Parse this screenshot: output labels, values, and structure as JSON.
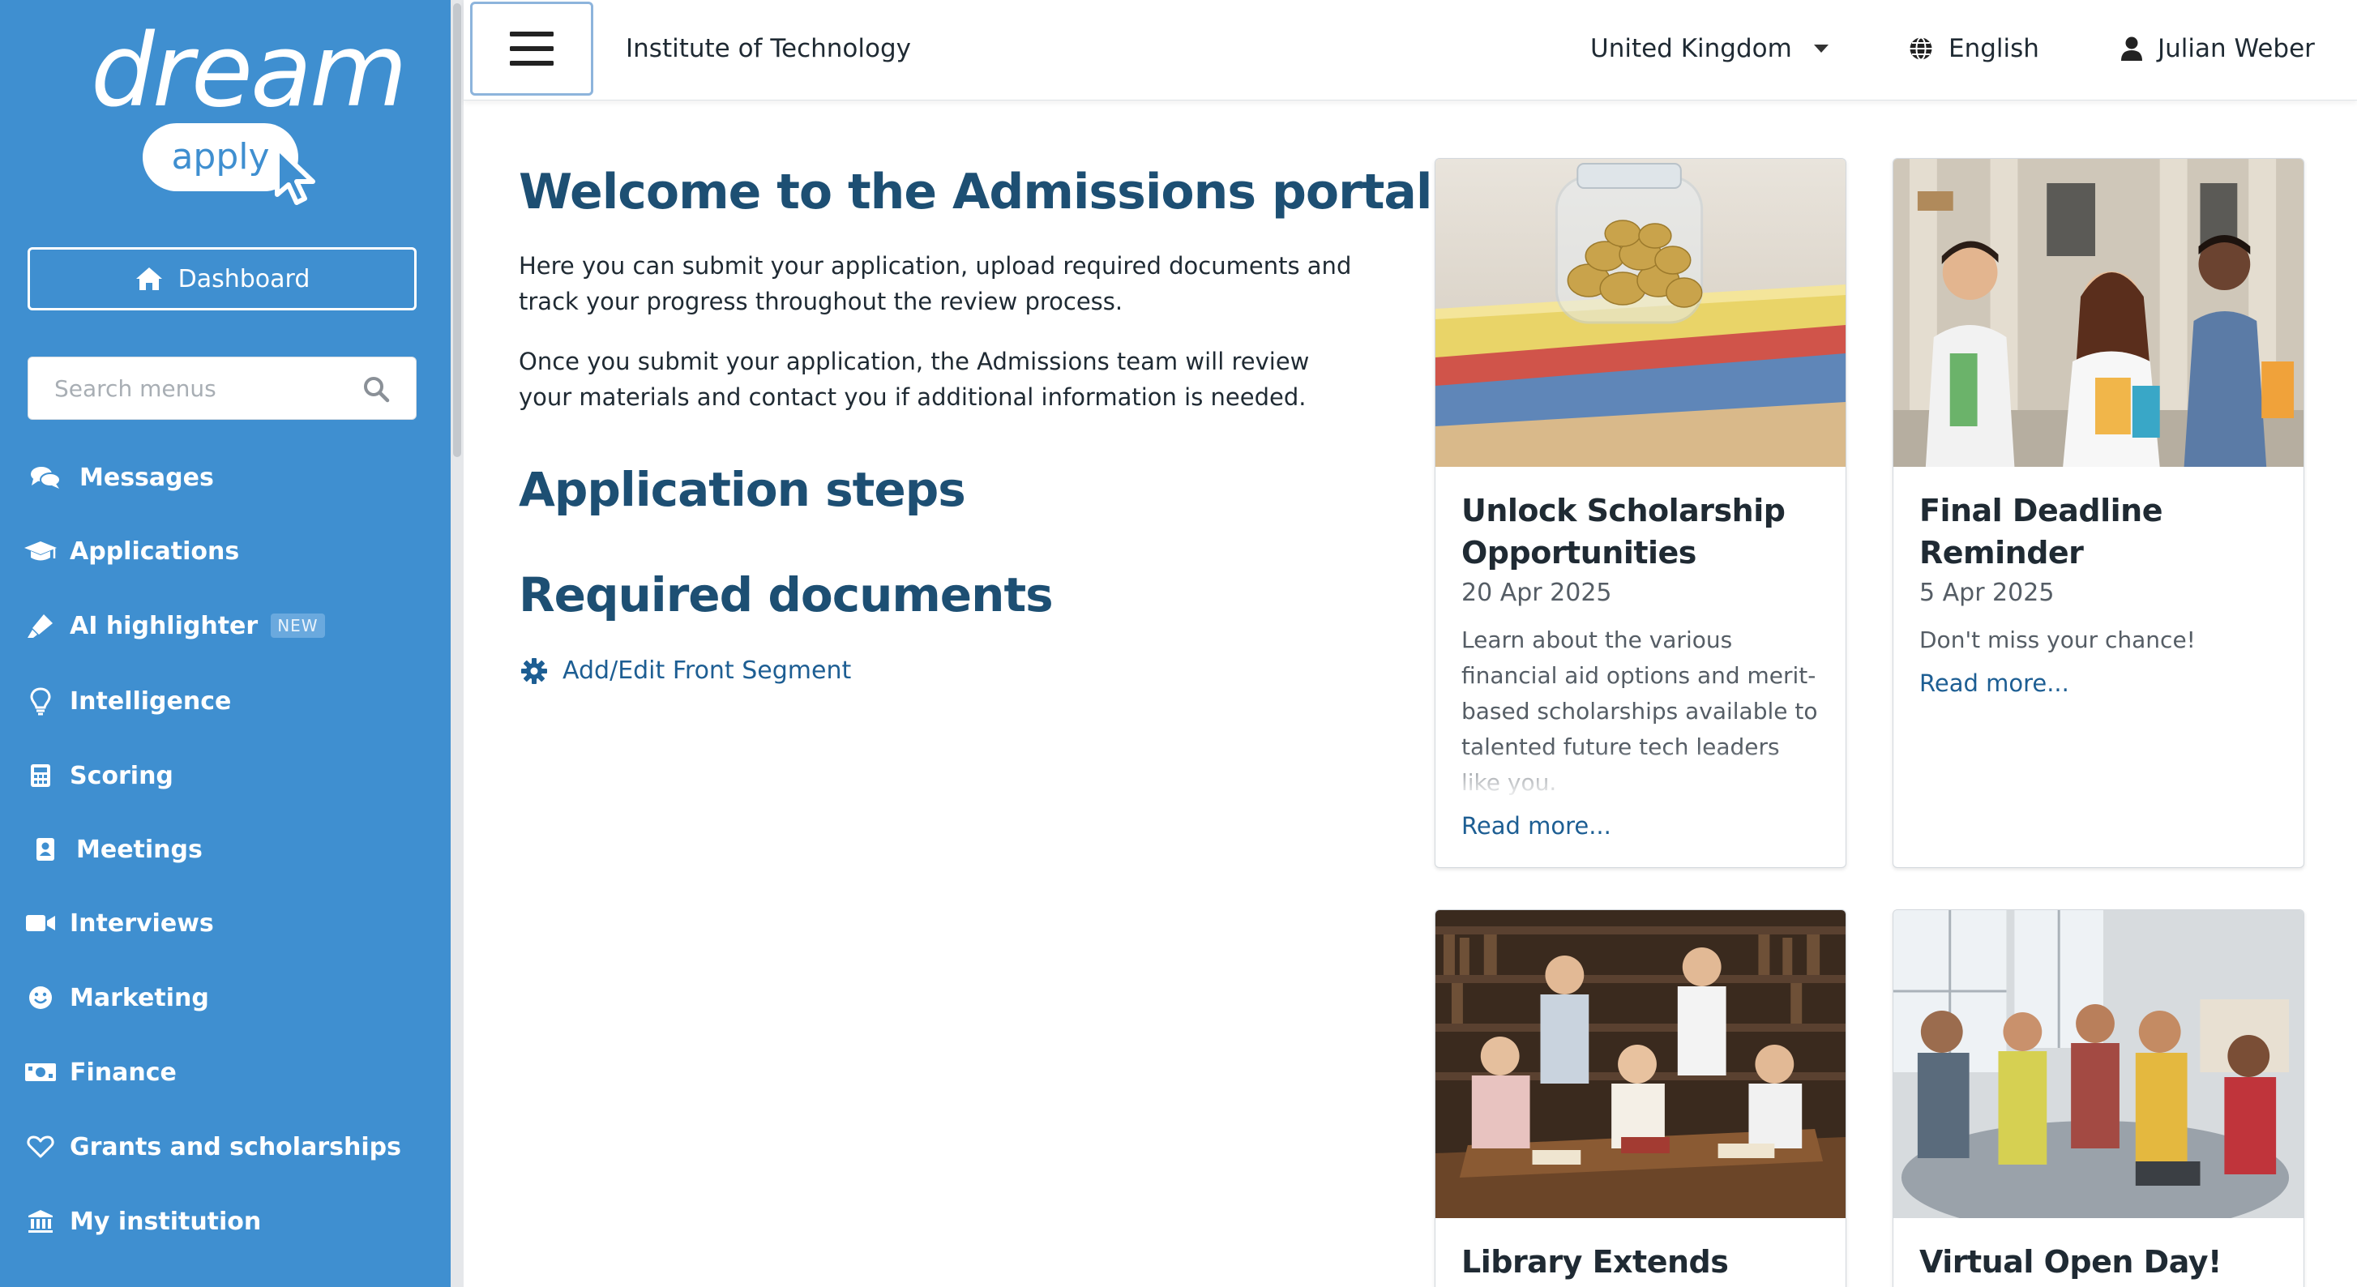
{
  "brand": {
    "word": "dream",
    "pill": "apply"
  },
  "sidebar": {
    "dashboard_label": "Dashboard",
    "search_placeholder": "Search menus",
    "items": [
      {
        "label": "Messages",
        "icon": "comments-icon"
      },
      {
        "label": "Applications",
        "icon": "graduation-cap-icon"
      },
      {
        "label": "AI highlighter",
        "icon": "highlighter-icon",
        "badge": "NEW"
      },
      {
        "label": "Intelligence",
        "icon": "lightbulb-icon"
      },
      {
        "label": "Scoring",
        "icon": "calculator-icon"
      },
      {
        "label": "Meetings",
        "icon": "address-book-icon"
      },
      {
        "label": "Interviews",
        "icon": "video-camera-icon"
      },
      {
        "label": "Marketing",
        "icon": "smile-icon"
      },
      {
        "label": "Finance",
        "icon": "money-bill-icon"
      },
      {
        "label": "Grants and scholarships",
        "icon": "heart-icon"
      },
      {
        "label": "My institution",
        "icon": "institution-icon"
      }
    ]
  },
  "header": {
    "title": "Institute of Technology",
    "country": "United Kingdom",
    "language": "English",
    "user": "Julian Weber"
  },
  "main": {
    "welcome_title": "Welcome to the Admissions portal",
    "intro_1": "Here you can submit your application, upload required documents and track your progress throughout the review process.",
    "intro_2": "Once you submit your application, the Admissions team will review your materials and contact you if additional information is needed.",
    "steps_title": "Application steps",
    "docs_title": "Required documents",
    "edit_link": "Add/Edit Front Segment"
  },
  "cards": [
    {
      "title": "Unlock Scholarship Opportunities",
      "date": "20 Apr 2025",
      "description": "Learn about the various financial aid options and merit-based scholarships available to talented future tech leaders like you.",
      "read_more": "Read more..."
    },
    {
      "title": "Final Deadline Reminder",
      "date": "5 Apr 2025",
      "description": "Don't miss your chance!",
      "read_more": "Read more..."
    },
    {
      "title": "Library Extends"
    },
    {
      "title": "Virtual Open Day!"
    }
  ],
  "colors": {
    "sidebar": "#3f8fd0",
    "heading": "#1d4f73",
    "link": "#1d5e93"
  }
}
